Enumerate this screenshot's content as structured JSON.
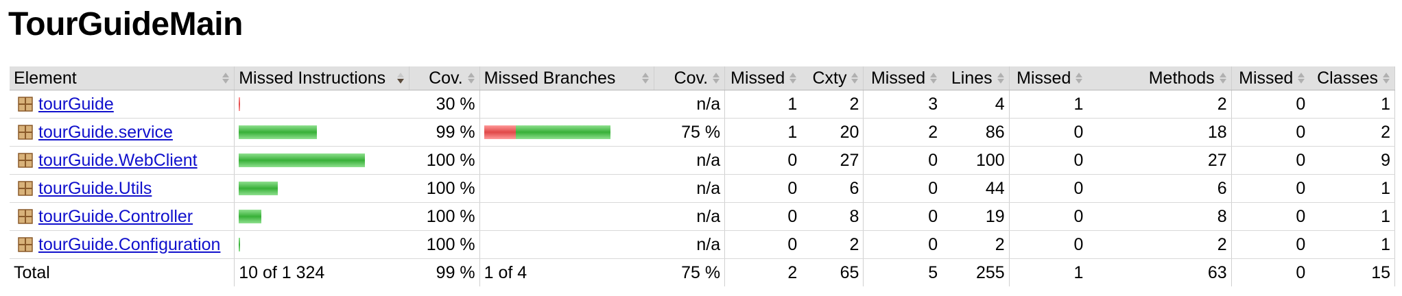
{
  "page_title": "TourGuideMain",
  "columns": [
    "Element",
    "Missed Instructions",
    "Cov.",
    "Missed Branches",
    "Cov.",
    "Missed",
    "Cxty",
    "Missed",
    "Lines",
    "Missed",
    "Methods",
    "Missed",
    "Classes"
  ],
  "colors": {
    "covered": "#38b038",
    "missed": "#e04848",
    "link": "#1010cc",
    "header_bg": "#e0e0e0"
  },
  "rows": [
    {
      "name": "tourGuide",
      "instr_missed_pct": 70,
      "instr_cov": "30 %",
      "branch_missed_pct": null,
      "branch_cov": "n/a",
      "cxty_missed": "1",
      "cxty": "2",
      "lines_missed": "3",
      "lines": "4",
      "methods_missed": "1",
      "methods": "2",
      "classes_missed": "0",
      "classes": "1",
      "instr_bar_width_fraction": 0.01
    },
    {
      "name": "tourGuide.service",
      "instr_missed_pct": 1,
      "instr_cov": "99 %",
      "branch_missed_pct": 25,
      "branch_cov": "75 %",
      "cxty_missed": "1",
      "cxty": "20",
      "lines_missed": "2",
      "lines": "86",
      "methods_missed": "0",
      "methods": "18",
      "classes_missed": "0",
      "classes": "2",
      "instr_bar_width_fraction": 0.62
    },
    {
      "name": "tourGuide.WebClient",
      "instr_missed_pct": 0,
      "instr_cov": "100 %",
      "branch_missed_pct": null,
      "branch_cov": "n/a",
      "cxty_missed": "0",
      "cxty": "27",
      "lines_missed": "0",
      "lines": "100",
      "methods_missed": "0",
      "methods": "27",
      "classes_missed": "0",
      "classes": "9",
      "instr_bar_width_fraction": 1.0
    },
    {
      "name": "tourGuide.Utils",
      "instr_missed_pct": 0,
      "instr_cov": "100 %",
      "branch_missed_pct": null,
      "branch_cov": "n/a",
      "cxty_missed": "0",
      "cxty": "6",
      "lines_missed": "0",
      "lines": "44",
      "methods_missed": "0",
      "methods": "6",
      "classes_missed": "0",
      "classes": "1",
      "instr_bar_width_fraction": 0.31
    },
    {
      "name": "tourGuide.Controller",
      "instr_missed_pct": 0,
      "instr_cov": "100 %",
      "branch_missed_pct": null,
      "branch_cov": "n/a",
      "cxty_missed": "0",
      "cxty": "8",
      "lines_missed": "0",
      "lines": "19",
      "methods_missed": "0",
      "methods": "8",
      "classes_missed": "0",
      "classes": "1",
      "instr_bar_width_fraction": 0.18
    },
    {
      "name": "tourGuide.Configuration",
      "instr_missed_pct": 0,
      "instr_cov": "100 %",
      "branch_missed_pct": null,
      "branch_cov": "n/a",
      "cxty_missed": "0",
      "cxty": "2",
      "lines_missed": "0",
      "lines": "2",
      "methods_missed": "0",
      "methods": "2",
      "classes_missed": "0",
      "classes": "1",
      "instr_bar_width_fraction": 0.01
    }
  ],
  "total": {
    "label": "Total",
    "instr": "10 of 1 324",
    "instr_cov": "99 %",
    "branch": "1 of 4",
    "branch_cov": "75 %",
    "cxty_missed": "2",
    "cxty": "65",
    "lines_missed": "5",
    "lines": "255",
    "methods_missed": "1",
    "methods": "63",
    "classes_missed": "0",
    "classes": "15"
  },
  "branch_bar_fraction": 1.0
}
